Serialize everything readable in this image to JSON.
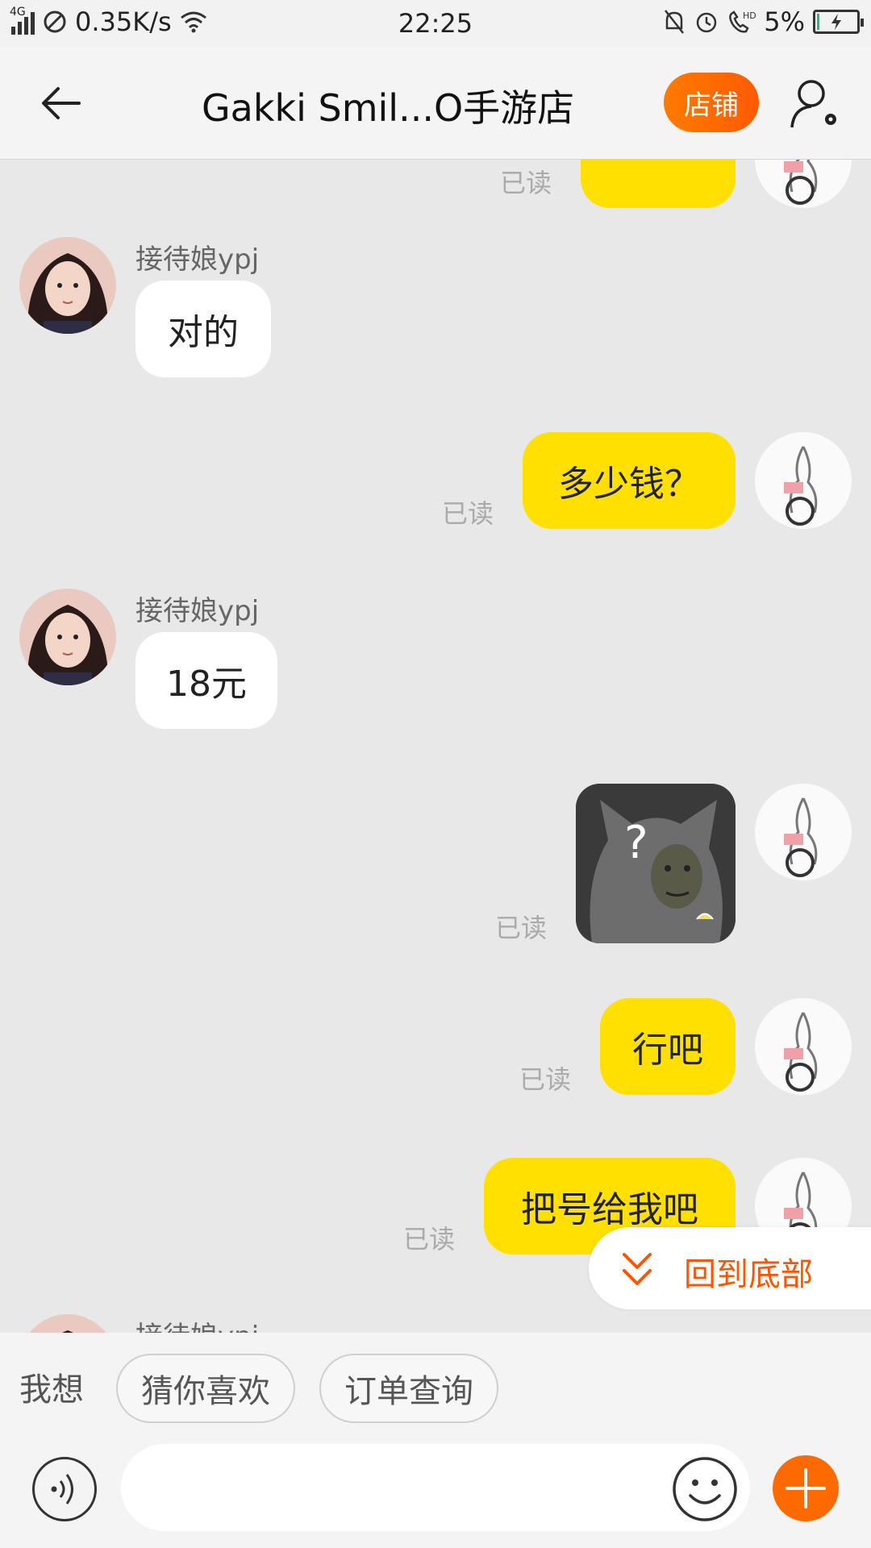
{
  "status_bar": {
    "network": "4G",
    "speed": "0.35K/s",
    "time": "22:25",
    "hd_label": "HD",
    "battery": "5%",
    "battery_level": 0.05
  },
  "header": {
    "title": "Gakki Smil...O手游店",
    "shop_button": "店铺"
  },
  "messages": [
    {
      "side": "right",
      "text": "",
      "read": "已读",
      "partial": true
    },
    {
      "side": "left",
      "sender": "接待娘ypj",
      "text": "对的"
    },
    {
      "side": "right",
      "text": "多少钱？",
      "read": "已读"
    },
    {
      "side": "left",
      "sender": "接待娘ypj",
      "text": "18元"
    },
    {
      "side": "right",
      "type": "sticker",
      "sticker_icon": "confused-meme-icon",
      "sticker_glyph": "?",
      "read": "已读"
    },
    {
      "side": "right",
      "text": "行吧",
      "read": "已读"
    },
    {
      "side": "right",
      "text": "把号给我吧",
      "read": "已读"
    },
    {
      "side": "left",
      "sender": "接待娘ypj",
      "partial": true
    }
  ],
  "back_to_bottom": "回到底部",
  "suggestions": {
    "label": "我想",
    "chips": [
      "猜你喜欢",
      "订单查询"
    ]
  },
  "input": {
    "placeholder": "",
    "value": ""
  },
  "colors": {
    "accent": "#ff6a00",
    "bubble_self": "#ffe000",
    "bubble_other": "#ffffff",
    "chat_bg": "#e8e8e8",
    "link": "#ff5500"
  }
}
